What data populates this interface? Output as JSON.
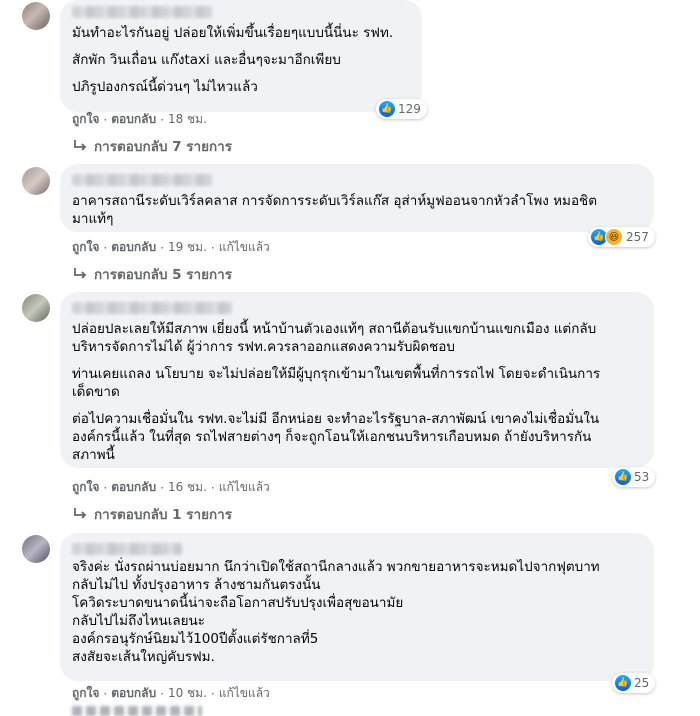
{
  "reply_icon_name": "reply-arrow-icon",
  "reaction_icons": [
    "like-icon",
    "haha-icon"
  ],
  "colors": {
    "like_blue": "#1877f2",
    "bubble_bg": "#f0f2f5",
    "meta_text": "#65676b"
  },
  "comments": [
    {
      "paragraphs": [
        [
          "มันทำอะไรกันอยู่ ปล่อยให้เพิ่มขึ้นเรื่อยๆแบบนี้นี่นะ รฟท."
        ],
        [
          "สักพัก วินเถื่อน แก๊งtaxi และอื่นๆจะมาอีกเพียบ"
        ],
        [
          "ปภิรูปองกรณ์นี้ด่วนๆ ไม่ไหวแล้ว"
        ]
      ],
      "reaction_count": "129",
      "like_label": "ถูกใจ",
      "reply_label": "ตอบกลับ",
      "time": "18 ชม.",
      "edited": "",
      "replies_label": "การตอบกลับ 7 รายการ"
    },
    {
      "paragraphs": [
        [
          "อาคารสถานีระดับเวิร์ลคลาส การจัดการระดับเวิร์ลแก๊ส อุส่าห์มูฟออนจากหัวลำโพง หมอชิต",
          "มาแท้ๆ"
        ]
      ],
      "reaction_count": "257",
      "like_label": "ถูกใจ",
      "reply_label": "ตอบกลับ",
      "time": "19 ชม.",
      "edited": "แก้ไขแล้ว",
      "replies_label": "การตอบกลับ 5 รายการ"
    },
    {
      "paragraphs": [
        [
          "ปล่อยปละเลยให้มีสภาพ เยี่ยงนี้ หน้าบ้านตัวเองแท้ๆ สถานีต้อนรับแขกบ้านแขกเมือง แต่กลับ",
          "บริหารจัดการไม่ได้ ผู้ว่าการ รฟท.ควรลาออกแสดงความรับผิดชอบ"
        ],
        [
          "ท่านเคยแถลง นโยบาย จะไม่ปล่อยให้มีผู้บุกรุกเข้ามาในเขตพื้นที่การรถไฟ โดยจะดำเนินการ",
          "เด็ดขาด"
        ],
        [
          "ต่อไปความเชื่อมั่นใน รฟท.จะไม่มี อีกหน่อย จะทำอะไรรัฐบาล-สภาพัฒน์ เขาคงไม่เชื่อมั่นใน",
          "องค์กรนี้แล้ว ในที่สุด รถไฟสายต่างๆ ก็จะถูกโอนให้เอกชนบริหารเกือบหมด ถ้ายังบริหารกัน",
          "สภาพนี้"
        ]
      ],
      "reaction_count": "53",
      "like_label": "ถูกใจ",
      "reply_label": "ตอบกลับ",
      "time": "16 ชม.",
      "edited": "แก้ไขแล้ว",
      "replies_label": "การตอบกลับ 1 รายการ"
    },
    {
      "paragraphs": [
        [
          "จริงค่ะ นั่งรถผ่านบ่อยมาก นึกว่าเปิดใช้สถานีกลางแล้ว พวกขายอาหารจะหมดไปจากฟุตบาท",
          "กลับไม่ไป ทั้งปรุงอาหาร ล้างชามกันตรงนั้น",
          "โควิดระบาดขนาดนี้น่าจะถือโอกาสปรับปรุงเพื่อสุขอนามัย",
          "กลับไปไม่ถึงไหนเลยนะ",
          "องค์กรอนุรักษ์นิยมไว้100ปีตั้งแต่รัชกาลที่5",
          "สงสัยจะเส้นใหญ่คับรฟม."
        ]
      ],
      "reaction_count": "25",
      "like_label": "ถูกใจ",
      "reply_label": "ตอบกลับ",
      "time": "10 ชม.",
      "edited": "แก้ไขแล้ว",
      "replies_label": ""
    }
  ]
}
